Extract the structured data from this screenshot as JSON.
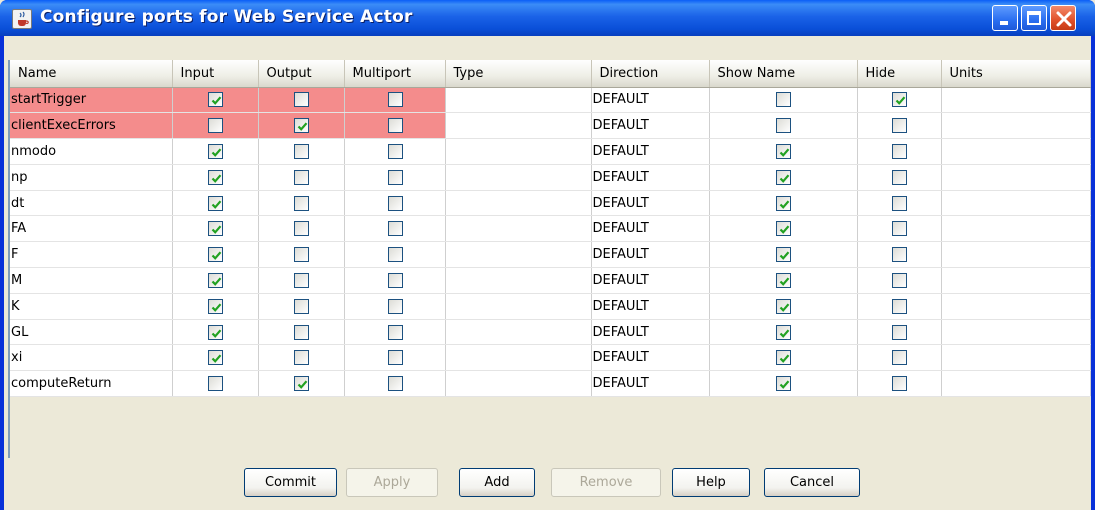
{
  "window": {
    "title": "Configure ports for Web Service Actor",
    "icon": "java-cup-icon"
  },
  "table": {
    "columns": [
      "Name",
      "Input",
      "Output",
      "Multiport",
      "Type",
      "Direction",
      "Show Name",
      "Hide",
      "Units"
    ],
    "rows": [
      {
        "name": "startTrigger",
        "input": true,
        "output": false,
        "multiport": false,
        "type": "",
        "direction": "DEFAULT",
        "show_name": false,
        "hide": true,
        "units": "",
        "highlight": true
      },
      {
        "name": "clientExecErrors",
        "input": false,
        "output": true,
        "multiport": false,
        "type": "",
        "direction": "DEFAULT",
        "show_name": false,
        "hide": false,
        "units": "",
        "highlight": true
      },
      {
        "name": "nmodo",
        "input": true,
        "output": false,
        "multiport": false,
        "type": "",
        "direction": "DEFAULT",
        "show_name": true,
        "hide": false,
        "units": "",
        "highlight": false
      },
      {
        "name": "np",
        "input": true,
        "output": false,
        "multiport": false,
        "type": "",
        "direction": "DEFAULT",
        "show_name": true,
        "hide": false,
        "units": "",
        "highlight": false
      },
      {
        "name": "dt",
        "input": true,
        "output": false,
        "multiport": false,
        "type": "",
        "direction": "DEFAULT",
        "show_name": true,
        "hide": false,
        "units": "",
        "highlight": false
      },
      {
        "name": "FA",
        "input": true,
        "output": false,
        "multiport": false,
        "type": "",
        "direction": "DEFAULT",
        "show_name": true,
        "hide": false,
        "units": "",
        "highlight": false
      },
      {
        "name": "F",
        "input": true,
        "output": false,
        "multiport": false,
        "type": "",
        "direction": "DEFAULT",
        "show_name": true,
        "hide": false,
        "units": "",
        "highlight": false
      },
      {
        "name": "M",
        "input": true,
        "output": false,
        "multiport": false,
        "type": "",
        "direction": "DEFAULT",
        "show_name": true,
        "hide": false,
        "units": "",
        "highlight": false
      },
      {
        "name": "K",
        "input": true,
        "output": false,
        "multiport": false,
        "type": "",
        "direction": "DEFAULT",
        "show_name": true,
        "hide": false,
        "units": "",
        "highlight": false
      },
      {
        "name": "GL",
        "input": true,
        "output": false,
        "multiport": false,
        "type": "",
        "direction": "DEFAULT",
        "show_name": true,
        "hide": false,
        "units": "",
        "highlight": false
      },
      {
        "name": "xi",
        "input": true,
        "output": false,
        "multiport": false,
        "type": "",
        "direction": "DEFAULT",
        "show_name": true,
        "hide": false,
        "units": "",
        "highlight": false
      },
      {
        "name": "computeReturn",
        "input": false,
        "output": true,
        "multiport": false,
        "type": "",
        "direction": "DEFAULT",
        "show_name": true,
        "hide": false,
        "units": "",
        "highlight": false
      }
    ]
  },
  "buttons": {
    "commit": {
      "label": "Commit",
      "enabled": true
    },
    "apply": {
      "label": "Apply",
      "enabled": false
    },
    "add": {
      "label": "Add",
      "enabled": true
    },
    "remove": {
      "label": "Remove",
      "enabled": false
    },
    "help": {
      "label": "Help",
      "enabled": true
    },
    "cancel": {
      "label": "Cancel",
      "enabled": true
    }
  },
  "colors": {
    "highlight_row": "#f48c8c",
    "check_mark": "#21a121",
    "title_bar": "#0a4fd8"
  }
}
